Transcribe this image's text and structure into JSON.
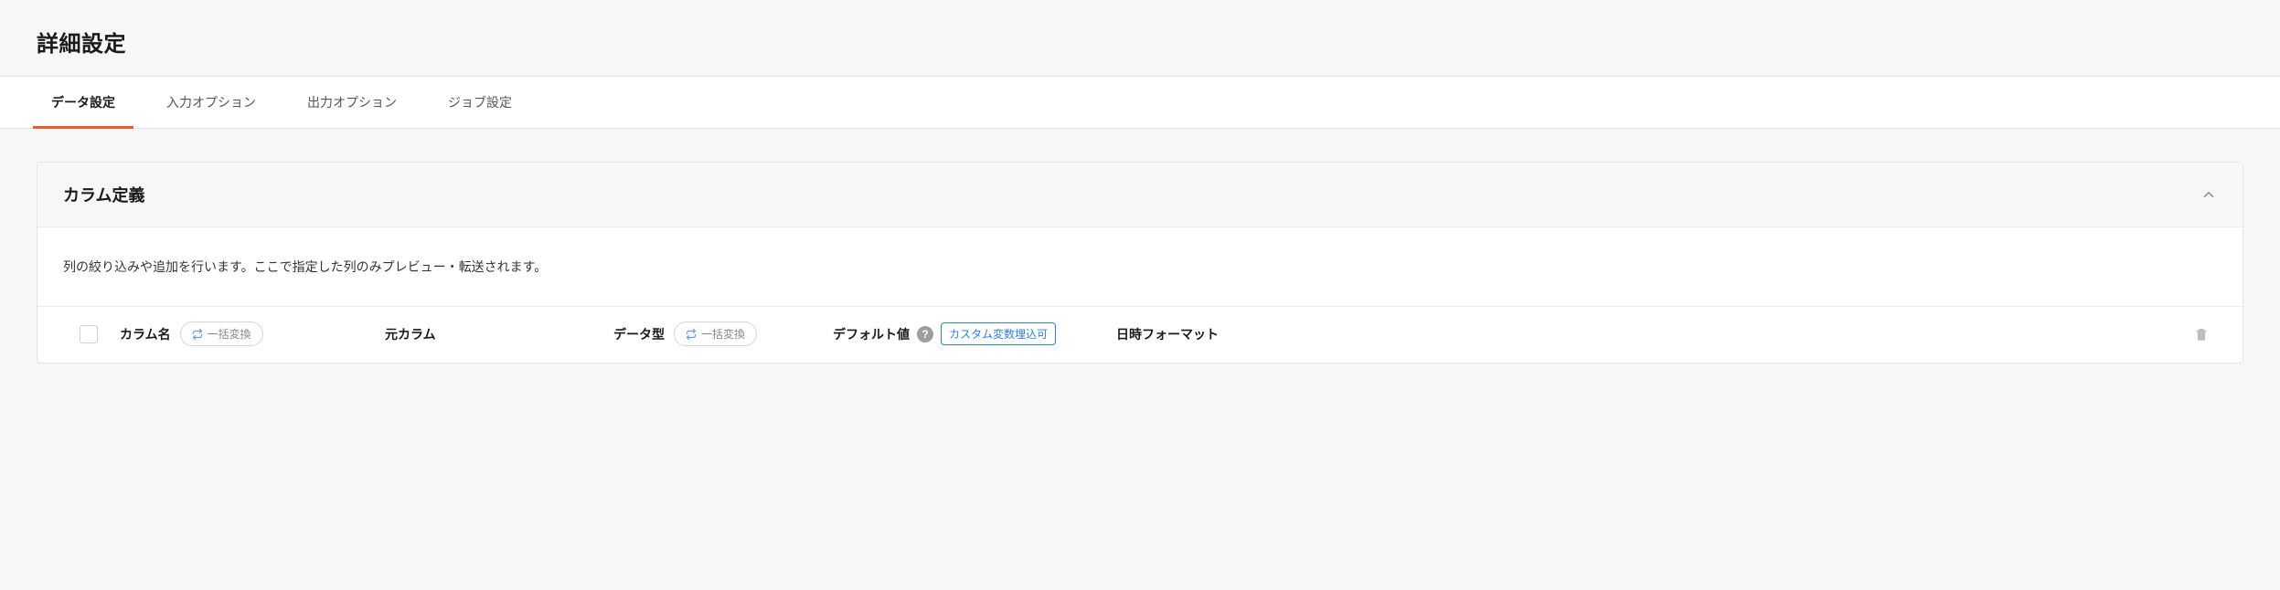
{
  "header": {
    "title": "詳細設定"
  },
  "tabs": [
    {
      "label": "データ設定",
      "active": true
    },
    {
      "label": "入力オプション",
      "active": false
    },
    {
      "label": "出力オプション",
      "active": false
    },
    {
      "label": "ジョブ設定",
      "active": false
    }
  ],
  "panel": {
    "title": "カラム定義",
    "description": "列の絞り込みや追加を行います。ここで指定した列のみプレビュー・転送されます。"
  },
  "table": {
    "headers": {
      "column_name": "カラム名",
      "source_column": "元カラム",
      "data_type": "データ型",
      "default_value": "デフォルト値",
      "datetime_format": "日時フォーマット"
    },
    "bulk_convert_label": "一括変換",
    "custom_var_badge": "カスタム変数埋込可",
    "help_char": "?"
  }
}
